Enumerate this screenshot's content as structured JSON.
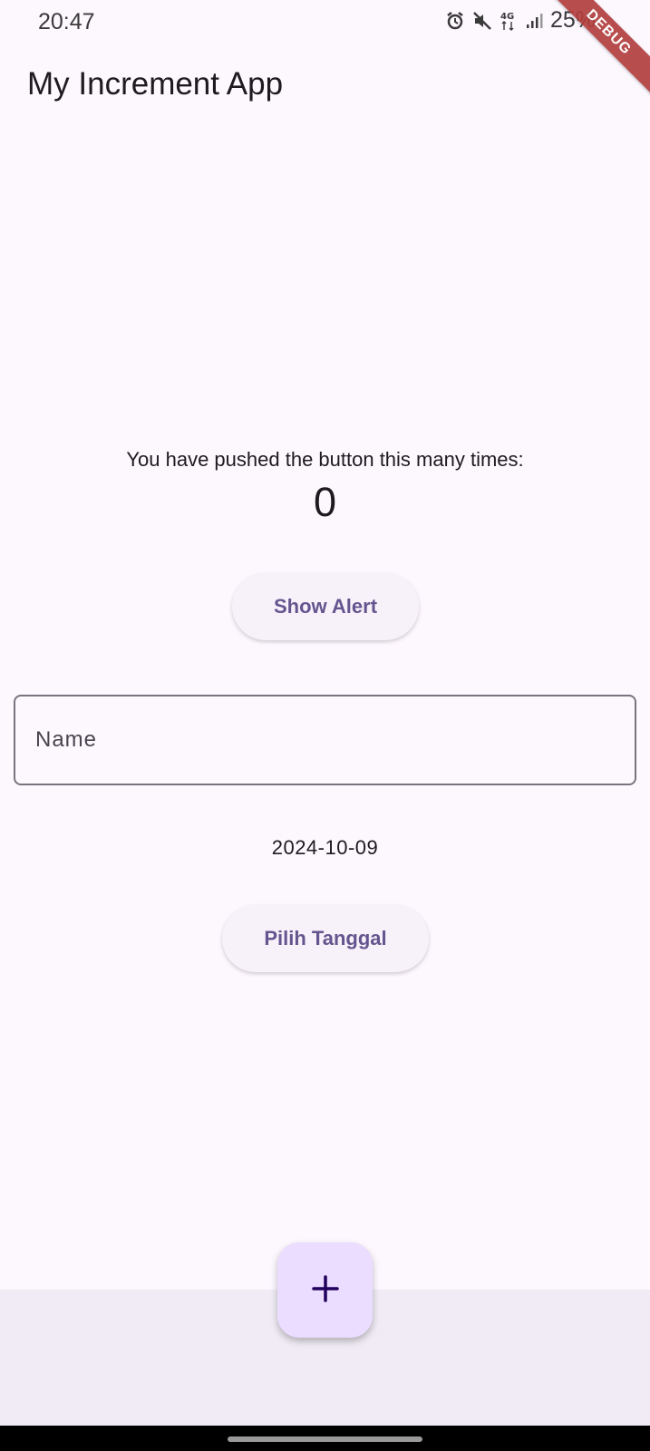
{
  "status_bar": {
    "time": "20:47",
    "network": "4G",
    "battery": "25%",
    "icons": [
      "alarm-icon",
      "mute-icon",
      "4g-icon",
      "signal-icon",
      "battery-icon"
    ]
  },
  "debug_banner": "DEBUG",
  "app_bar": {
    "title": "My Increment App"
  },
  "main": {
    "counter_label": "You have pushed the button this many times:",
    "counter_value": "0",
    "show_alert_label": "Show Alert",
    "name_field": {
      "placeholder": "Name",
      "value": ""
    },
    "date": "2024-10-09",
    "pick_date_label": "Pilih Tanggal"
  },
  "fab": {
    "icon": "plus-icon"
  },
  "colors": {
    "background": "#fdf7fe",
    "accent_text": "#65558f",
    "fab": "#eaddff",
    "bottom_area": "#f0ebf4"
  }
}
